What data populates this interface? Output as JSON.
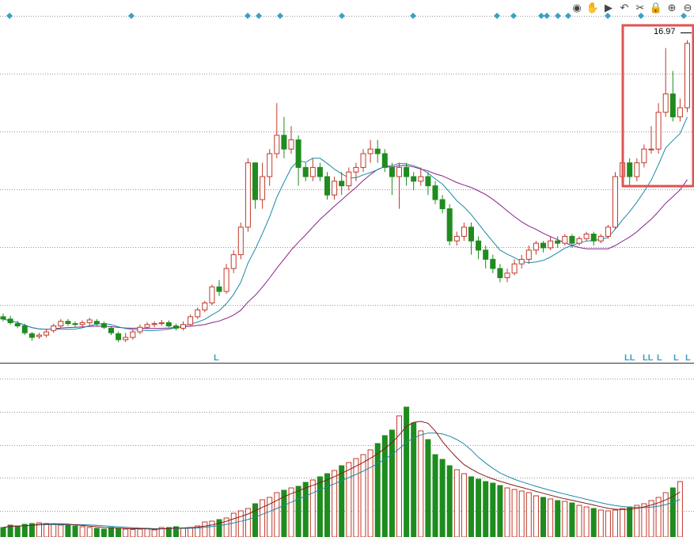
{
  "toolbar": {
    "icons": [
      "eye-icon",
      "hand-icon",
      "play-icon",
      "undo-icon",
      "scissors-icon",
      "lock-icon",
      "zoom-in-icon",
      "zoom-out-icon"
    ],
    "glyphs": [
      "◉",
      "✋",
      "▶",
      "↶",
      "✂",
      "🔒",
      "⊕",
      "⊖"
    ]
  },
  "price_marker": {
    "text": "16.97"
  },
  "markers": {
    "bottom_labels": [
      "L",
      "LL",
      "LL",
      "L",
      "L",
      "L"
    ]
  },
  "colors": {
    "up": "#c0392b",
    "down": "#1e8c1e",
    "ma_short": "#1a8aa8",
    "ma_long": "#8b1f8b",
    "vol_ma_short": "#8b1a1a",
    "vol_ma_long": "#1a8aa8",
    "highlight": "#e05252",
    "grid": "#999999",
    "diamond": "#3aa0c8"
  },
  "chart_data": {
    "type": "candlestick",
    "highlight_region": "right end",
    "price": {
      "candles_ohlc": [
        [
          10.95,
          10.9,
          11.02,
          10.85
        ],
        [
          10.9,
          10.82,
          10.97,
          10.78
        ],
        [
          10.8,
          10.75,
          10.86,
          10.7
        ],
        [
          10.75,
          10.6,
          10.8,
          10.55
        ],
        [
          10.58,
          10.5,
          10.62,
          10.43
        ],
        [
          10.52,
          10.55,
          10.6,
          10.47
        ],
        [
          10.55,
          10.62,
          10.68,
          10.5
        ],
        [
          10.65,
          10.75,
          10.8,
          10.6
        ],
        [
          10.75,
          10.85,
          10.9,
          10.7
        ],
        [
          10.85,
          10.8,
          10.9,
          10.75
        ],
        [
          10.8,
          10.78,
          10.85,
          10.72
        ],
        [
          10.78,
          10.82,
          10.87,
          10.72
        ],
        [
          10.82,
          10.88,
          10.93,
          10.77
        ],
        [
          10.85,
          10.8,
          10.9,
          10.75
        ],
        [
          10.8,
          10.72,
          10.85,
          10.68
        ],
        [
          10.7,
          10.6,
          10.75,
          10.55
        ],
        [
          10.58,
          10.45,
          10.63,
          10.4
        ],
        [
          10.45,
          10.5,
          10.6,
          10.4
        ],
        [
          10.5,
          10.62,
          10.68,
          10.45
        ],
        [
          10.62,
          10.72,
          10.78,
          10.57
        ],
        [
          10.72,
          10.78,
          10.83,
          10.68
        ],
        [
          10.78,
          10.8,
          10.85,
          10.72
        ],
        [
          10.8,
          10.82,
          10.88,
          10.75
        ],
        [
          10.82,
          10.75,
          10.87,
          10.72
        ],
        [
          10.75,
          10.7,
          10.8,
          10.65
        ],
        [
          10.7,
          10.78,
          10.85,
          10.65
        ],
        [
          10.78,
          10.95,
          11.0,
          10.75
        ],
        [
          10.95,
          11.1,
          11.15,
          10.9
        ],
        [
          11.1,
          11.25,
          11.3,
          11.05
        ],
        [
          11.25,
          11.6,
          11.65,
          11.2
        ],
        [
          11.6,
          11.5,
          11.75,
          11.4
        ],
        [
          11.5,
          12.0,
          12.1,
          11.45
        ],
        [
          12.0,
          12.3,
          12.4,
          11.9
        ],
        [
          12.3,
          12.9,
          13.0,
          12.2
        ],
        [
          12.9,
          14.3,
          14.4,
          12.8
        ],
        [
          14.3,
          13.5,
          14.0,
          13.3
        ],
        [
          13.5,
          14.0,
          14.3,
          13.3
        ],
        [
          14.0,
          14.5,
          14.6,
          13.8
        ],
        [
          14.5,
          14.9,
          15.6,
          14.4
        ],
        [
          14.9,
          14.6,
          15.3,
          14.4
        ],
        [
          14.6,
          14.8,
          15.1,
          14.5
        ],
        [
          14.8,
          14.2,
          14.9,
          13.8
        ],
        [
          14.2,
          14.0,
          14.3,
          13.9
        ],
        [
          14.0,
          14.2,
          14.4,
          13.9
        ],
        [
          14.2,
          14.0,
          14.3,
          13.9
        ],
        [
          14.0,
          13.6,
          14.1,
          13.5
        ],
        [
          13.6,
          13.9,
          14.0,
          13.5
        ],
        [
          13.9,
          13.8,
          14.1,
          13.6
        ],
        [
          13.8,
          14.1,
          14.2,
          13.7
        ],
        [
          14.1,
          14.2,
          14.3,
          13.9
        ],
        [
          14.2,
          14.5,
          14.6,
          14.1
        ],
        [
          14.5,
          14.6,
          14.8,
          14.3
        ],
        [
          14.6,
          14.5,
          14.8,
          14.3
        ],
        [
          14.5,
          14.2,
          14.6,
          14.1
        ],
        [
          14.2,
          14.0,
          14.3,
          13.6
        ],
        [
          14.0,
          14.2,
          14.3,
          13.3
        ],
        [
          14.2,
          14.0,
          14.3,
          13.8
        ],
        [
          14.0,
          13.9,
          14.1,
          13.7
        ],
        [
          13.9,
          14.0,
          14.2,
          13.8
        ],
        [
          14.0,
          13.8,
          14.1,
          13.6
        ],
        [
          13.8,
          13.5,
          13.9,
          13.4
        ],
        [
          13.5,
          13.3,
          13.6,
          13.2
        ],
        [
          13.3,
          12.6,
          13.4,
          12.5
        ],
        [
          12.6,
          12.7,
          12.8,
          12.5
        ],
        [
          12.7,
          12.9,
          13.0,
          12.6
        ],
        [
          12.9,
          12.6,
          13.0,
          12.3
        ],
        [
          12.6,
          12.4,
          12.7,
          12.2
        ],
        [
          12.4,
          12.2,
          12.5,
          12.0
        ],
        [
          12.2,
          12.0,
          12.3,
          11.9
        ],
        [
          12.0,
          11.8,
          12.1,
          11.7
        ],
        [
          11.8,
          11.9,
          12.0,
          11.7
        ],
        [
          11.9,
          12.1,
          12.2,
          11.85
        ],
        [
          12.1,
          12.2,
          12.3,
          12.0
        ],
        [
          12.2,
          12.4,
          12.5,
          12.1
        ],
        [
          12.4,
          12.55,
          12.6,
          12.3
        ],
        [
          12.55,
          12.45,
          12.6,
          12.35
        ],
        [
          12.45,
          12.6,
          12.7,
          12.4
        ],
        [
          12.6,
          12.55,
          12.7,
          12.45
        ],
        [
          12.55,
          12.7,
          12.75,
          12.5
        ],
        [
          12.7,
          12.55,
          12.75,
          12.45
        ],
        [
          12.55,
          12.65,
          12.7,
          12.5
        ],
        [
          12.65,
          12.75,
          12.8,
          12.6
        ],
        [
          12.75,
          12.6,
          12.8,
          12.5
        ],
        [
          12.6,
          12.7,
          12.75,
          12.55
        ],
        [
          12.7,
          12.9,
          12.95,
          12.65
        ],
        [
          12.9,
          14.0,
          14.1,
          12.85
        ],
        [
          14.0,
          14.3,
          14.4,
          13.9
        ],
        [
          14.3,
          14.0,
          14.4,
          13.8
        ],
        [
          14.0,
          14.3,
          14.4,
          13.9
        ],
        [
          14.3,
          14.6,
          14.7,
          14.2
        ],
        [
          14.6,
          14.6,
          15.1,
          14.5
        ],
        [
          14.6,
          15.4,
          15.6,
          14.5
        ],
        [
          15.4,
          15.8,
          16.8,
          15.3
        ],
        [
          15.8,
          15.3,
          16.3,
          15.2
        ],
        [
          15.3,
          15.5,
          15.7,
          15.2
        ],
        [
          15.5,
          16.9,
          16.97,
          15.4
        ]
      ]
    },
    "volume": {
      "values": [
        120,
        150,
        140,
        160,
        170,
        180,
        170,
        160,
        150,
        150,
        140,
        130,
        120,
        110,
        100,
        120,
        110,
        100,
        95,
        100,
        110,
        90,
        120,
        120,
        130,
        110,
        120,
        140,
        190,
        200,
        220,
        240,
        300,
        330,
        360,
        420,
        470,
        500,
        560,
        590,
        620,
        640,
        690,
        720,
        760,
        800,
        840,
        900,
        940,
        990,
        1040,
        1100,
        1180,
        1280,
        1350,
        1530,
        1640,
        1440,
        1340,
        1230,
        1040,
        980,
        900,
        850,
        800,
        760,
        730,
        700,
        680,
        650,
        620,
        600,
        580,
        560,
        520,
        500,
        480,
        460,
        450,
        430,
        400,
        380,
        360,
        340,
        330,
        340,
        360,
        380,
        400,
        420,
        460,
        500,
        560,
        620,
        700
      ]
    }
  }
}
